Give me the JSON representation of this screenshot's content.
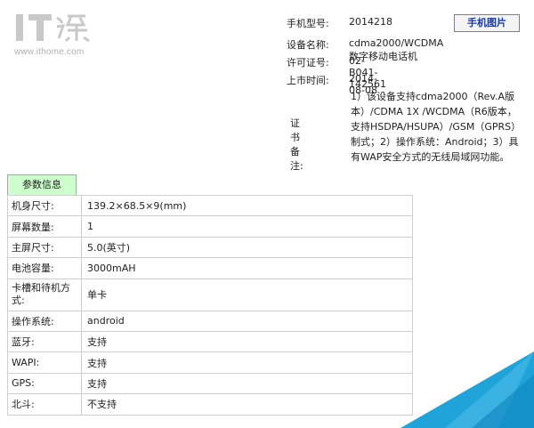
{
  "logo": {
    "url_text": "www.ithome.com"
  },
  "info": {
    "model_label": "手机型号:",
    "model_value": "2014218",
    "device_label": "设备名称:",
    "device_value": "cdma2000/WCDMA数字移动电话机",
    "license_label": "许可证号:",
    "license_value": "02-B041-142561",
    "launch_label": "上市时间:",
    "launch_value": "2014-08-08",
    "note_label": "证书备注:",
    "note_value": "1）该设备支持cdma2000（Rev.A版本）/CDMA 1X /WCDMA（R6版本，支持HSDPA/HSUPA）/GSM（GPRS）制式；2）操作系统：Android；3）具有WAP安全方式的无线局域网功能。",
    "phone_pic_button": "手机图片"
  },
  "params": {
    "tab_label": "参数信息",
    "rows": [
      {
        "key": "机身尺寸:",
        "value": "139.2×68.5×9(mm)"
      },
      {
        "key": "屏幕数量:",
        "value": "1"
      },
      {
        "key": "主屏尺寸:",
        "value": "5.0(英寸)"
      },
      {
        "key": "电池容量:",
        "value": "3000mAH"
      },
      {
        "key": "卡槽和待机方式:",
        "value": "单卡"
      },
      {
        "key": "操作系统:",
        "value": "android"
      },
      {
        "key": "蓝牙:",
        "value": "支持"
      },
      {
        "key": "WAPI:",
        "value": "支持"
      },
      {
        "key": "GPS:",
        "value": "支持"
      },
      {
        "key": "北斗:",
        "value": "不支持"
      }
    ]
  },
  "colors": {
    "tab_bg": "#ccffcc",
    "button_text": "#1a3b9a",
    "corner_blue": "#1fa3d8"
  }
}
